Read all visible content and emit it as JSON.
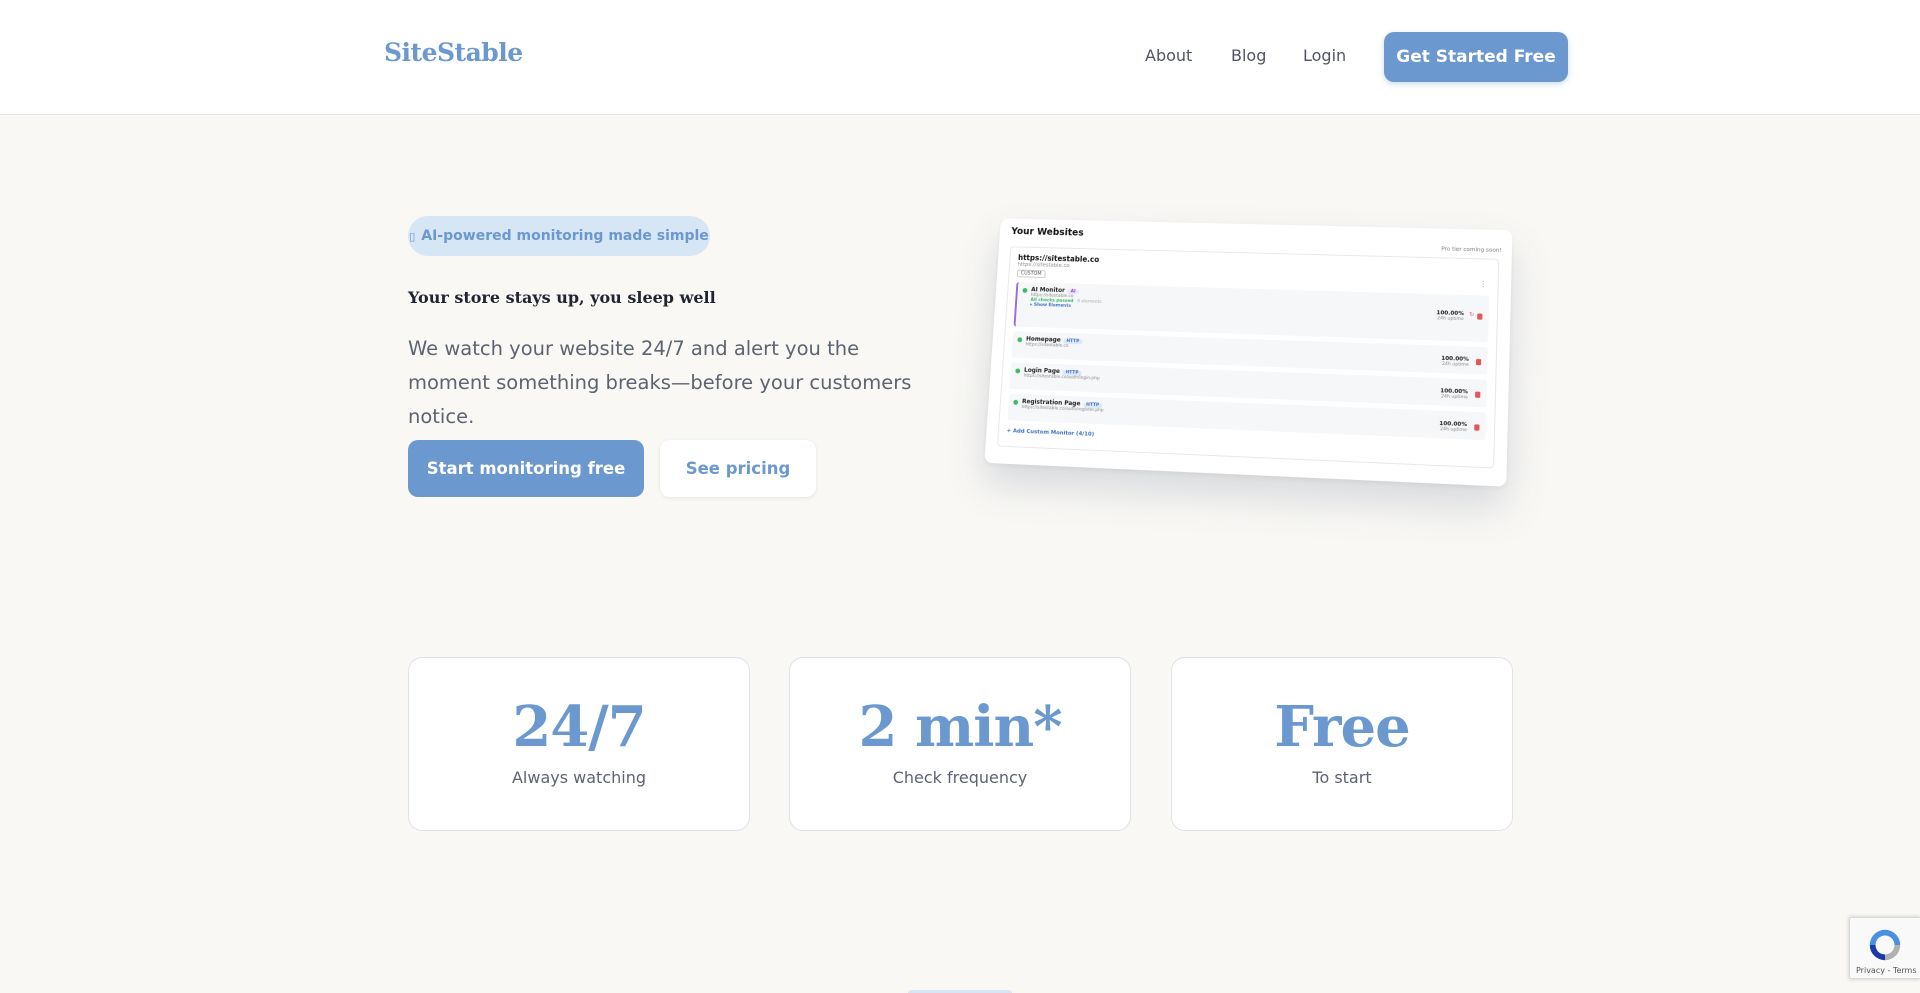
{
  "header": {
    "logo": "SiteStable",
    "nav": {
      "about": "About",
      "blog": "Blog",
      "login": "Login"
    },
    "cta": "Get Started Free"
  },
  "hero": {
    "pill": "AI-powered monitoring made simple",
    "pill_icon": "sparkle-icon",
    "tagline": "Your store stays up, you sleep well",
    "description": "We watch your website 24/7 and alert you the moment something breaks—before your customers notice.",
    "primary_button": "Start monitoring free",
    "secondary_button": "See pricing"
  },
  "preview": {
    "title": "Your Websites",
    "pro_note": "Pro tier coming soon!",
    "site": {
      "url": "https://sitestable.co",
      "sub_url": "https://sitestable.co",
      "chip": "CUSTOM"
    },
    "monitors": [
      {
        "name": "AI Monitor",
        "tag": "AI",
        "url": "https://sitestable.co",
        "status": "All checks passed",
        "elements": "6 elements",
        "show": "▸ Show Elements",
        "uptime": "100.00%",
        "uptime_label": "24h uptime"
      },
      {
        "name": "Homepage",
        "tag": "HTTP",
        "url": "https://sitestable.co",
        "uptime": "100.00%",
        "uptime_label": "24h uptime"
      },
      {
        "name": "Login Page",
        "tag": "HTTP",
        "url": "https://sitestable.co/auth/login.php",
        "uptime": "100.00%",
        "uptime_label": "24h uptime"
      },
      {
        "name": "Registration Page",
        "tag": "HTTP",
        "url": "https://sitestable.co/auth/register.php",
        "uptime": "100.00%",
        "uptime_label": "24h uptime"
      }
    ],
    "add_monitor": "+ Add Custom Monitor (4/10)"
  },
  "stats": [
    {
      "value": "24/7",
      "label": "Always watching"
    },
    {
      "value": "2 min*",
      "label": "Check frequency"
    },
    {
      "value": "Free",
      "label": "To start"
    }
  ],
  "recaptcha": {
    "text": "Privacy - Terms"
  },
  "colors": {
    "accent": "#6b98cf",
    "pill_bg": "#d7e6f5",
    "page_bg": "#f9f8f5",
    "success": "#3cba6a"
  }
}
